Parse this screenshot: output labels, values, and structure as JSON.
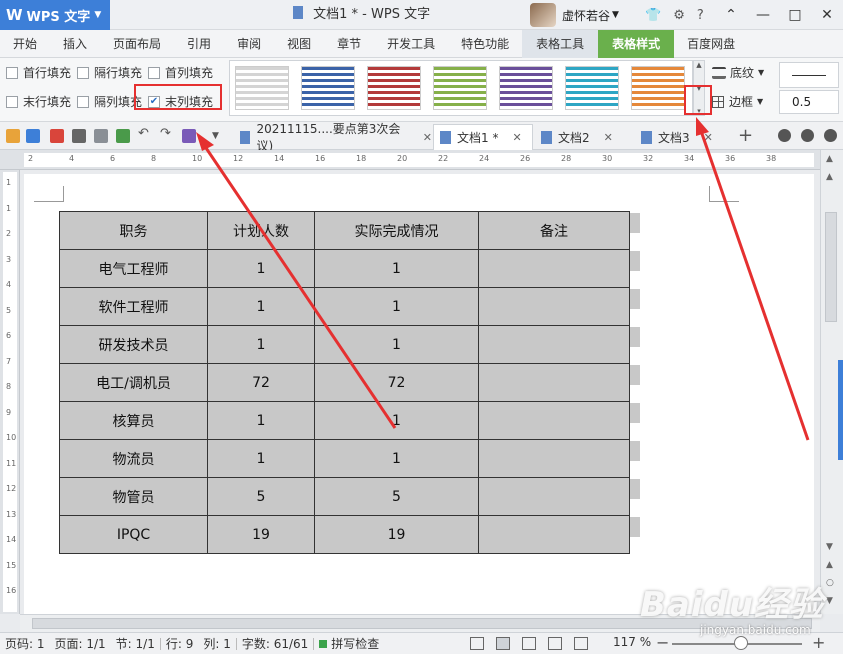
{
  "app": {
    "logo": "WPS 文字",
    "title": "文档1 * - WPS 文字",
    "user": "虚怀若谷"
  },
  "menu": [
    "开始",
    "插入",
    "页面布局",
    "引用",
    "审阅",
    "视图",
    "章节",
    "开发工具",
    "特色功能",
    "表格工具",
    "表格样式",
    "百度网盘"
  ],
  "ribbon": {
    "options": [
      {
        "label": "首行填充",
        "checked": false
      },
      {
        "label": "隔行填充",
        "checked": false
      },
      {
        "label": "首列填充",
        "checked": false
      },
      {
        "label": "末行填充",
        "checked": false
      },
      {
        "label": "隔列填充",
        "checked": false
      },
      {
        "label": "末列填充",
        "checked": true
      }
    ],
    "style_colors": [
      "#d4d4d4",
      "#3b63a8",
      "#b33a3a",
      "#86b04a",
      "#6a4f9a",
      "#2ea6c4",
      "#e5883a"
    ],
    "shading_label": "底纹",
    "border_label": "边框",
    "line_width": "0.5"
  },
  "tabs": [
    {
      "label": "20211115....要点第3次会议)",
      "active": false
    },
    {
      "label": "文档1 *",
      "active": true
    },
    {
      "label": "文档2",
      "active": false
    },
    {
      "label": "文档3",
      "active": false
    }
  ],
  "ruler": {
    "h": [
      "2",
      "4",
      "6",
      "8",
      "10",
      "12",
      "14",
      "16",
      "18",
      "20",
      "22",
      "24",
      "26",
      "28",
      "30",
      "32",
      "34",
      "36",
      "38"
    ],
    "v": [
      "1",
      "1",
      "2",
      "3",
      "4",
      "5",
      "6",
      "7",
      "8",
      "9",
      "10",
      "11",
      "12",
      "13",
      "14",
      "15",
      "16"
    ]
  },
  "table": {
    "headers": [
      "职务",
      "计划人数",
      "实际完成情况",
      "备注"
    ],
    "rows": [
      [
        "电气工程师",
        "1",
        "1",
        ""
      ],
      [
        "软件工程师",
        "1",
        "1",
        ""
      ],
      [
        "研发技术员",
        "1",
        "1",
        ""
      ],
      [
        "电工/调机员",
        "72",
        "72",
        ""
      ],
      [
        "核算员",
        "1",
        "1",
        ""
      ],
      [
        "物流员",
        "1",
        "1",
        ""
      ],
      [
        "物管员",
        "5",
        "5",
        ""
      ],
      [
        "IPQC",
        "19",
        "19",
        ""
      ]
    ]
  },
  "status": {
    "page": "页码: 1",
    "pages": "页面: 1/1",
    "section": "节: 1/1",
    "row": "行: 9",
    "col": "列: 1",
    "words": "字数: 61/61",
    "spell": "拼写检查",
    "zoom": "117 %"
  },
  "watermark": {
    "brand": "Baidu经验",
    "url": "jingyan.baidu.com"
  },
  "colors": {
    "accent": "#3d7fd8",
    "active_tab": "#6ab04c",
    "highlight": "#e53030"
  }
}
